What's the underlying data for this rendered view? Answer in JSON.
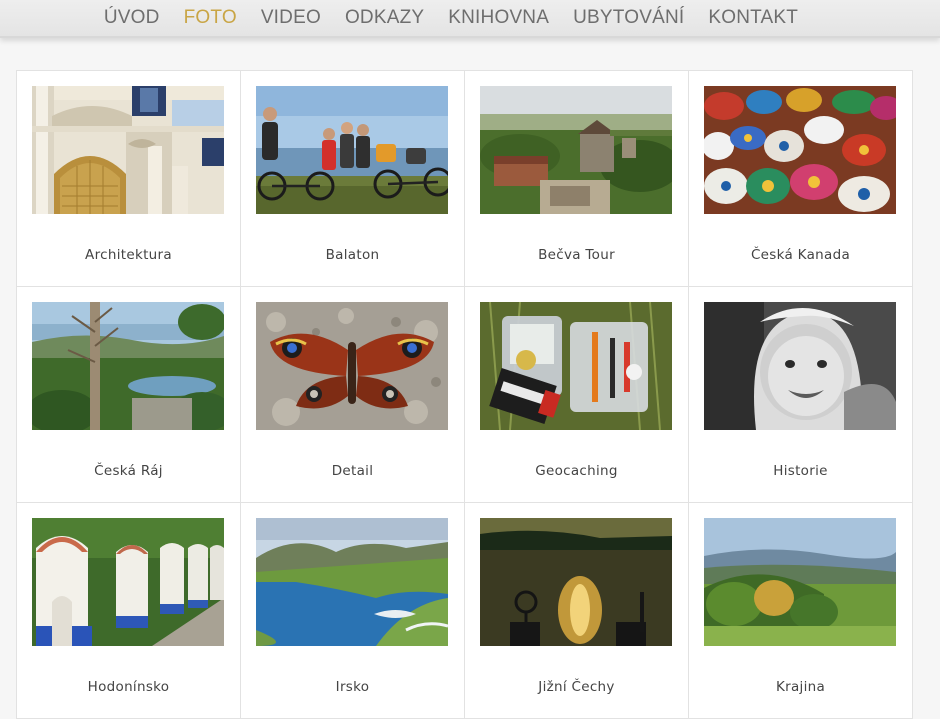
{
  "nav": {
    "items": [
      {
        "label": "ÚVOD",
        "active": false
      },
      {
        "label": "FOTO",
        "active": true
      },
      {
        "label": "VIDEO",
        "active": false
      },
      {
        "label": "ODKAZY",
        "active": false
      },
      {
        "label": "KNIHOVNA",
        "active": false
      },
      {
        "label": "UBYTOVÁNÍ",
        "active": false
      },
      {
        "label": "KONTAKT",
        "active": false
      }
    ],
    "active_color": "#c9a545",
    "text_color": "#6e6e6e"
  },
  "gallery": {
    "albums": [
      {
        "title": "Architektura"
      },
      {
        "title": "Balaton"
      },
      {
        "title": "Bečva Tour"
      },
      {
        "title": "Česká Kanada"
      },
      {
        "title": "Česká Ráj"
      },
      {
        "title": "Detail"
      },
      {
        "title": "Geocaching"
      },
      {
        "title": "Historie"
      },
      {
        "title": "Hodonínsko"
      },
      {
        "title": "Irsko"
      },
      {
        "title": "Jižní Čechy"
      },
      {
        "title": "Krajina"
      }
    ]
  }
}
